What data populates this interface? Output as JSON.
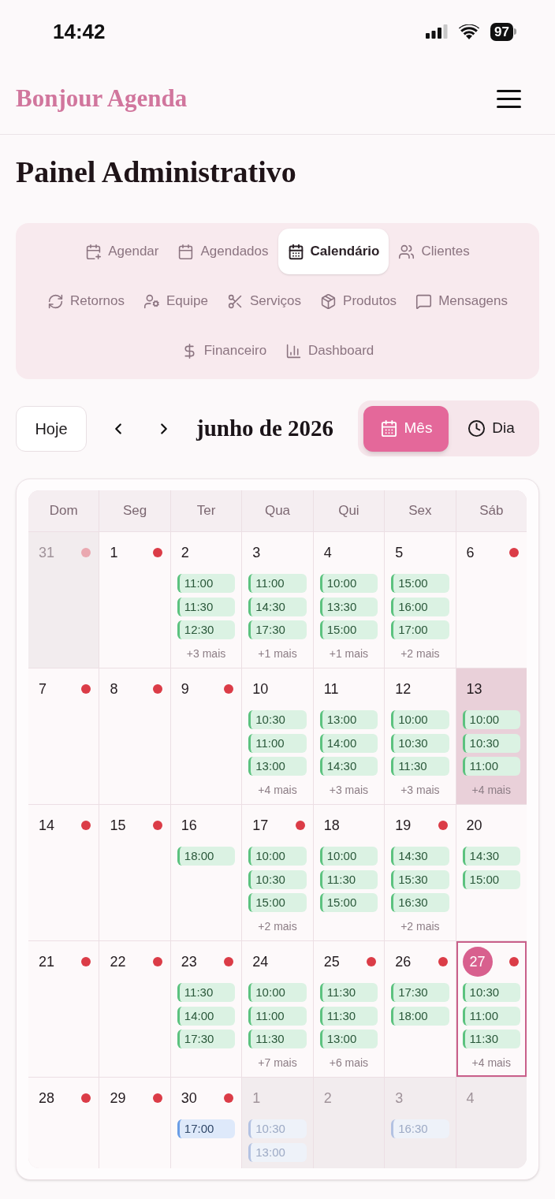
{
  "status_bar": {
    "time": "14:42",
    "battery": "97"
  },
  "header": {
    "brand": "Bonjour Agenda"
  },
  "page_title": "Painel Administrativo",
  "nav": [
    {
      "label": "Agendar",
      "selected": false
    },
    {
      "label": "Agendados",
      "selected": false
    },
    {
      "label": "Calendário",
      "selected": true
    },
    {
      "label": "Clientes",
      "selected": false
    },
    {
      "label": "Retornos",
      "selected": false
    },
    {
      "label": "Equipe",
      "selected": false
    },
    {
      "label": "Serviços",
      "selected": false
    },
    {
      "label": "Produtos",
      "selected": false
    },
    {
      "label": "Mensagens",
      "selected": false
    },
    {
      "label": "Financeiro",
      "selected": false
    },
    {
      "label": "Dashboard",
      "selected": false
    }
  ],
  "toolbar": {
    "today": "Hoje",
    "month_title": "junho de 2026"
  },
  "view_modes": [
    {
      "label": "Mês",
      "selected": true
    },
    {
      "label": "Dia",
      "selected": false
    }
  ],
  "calendar": {
    "weekdays": [
      "Dom",
      "Seg",
      "Ter",
      "Qua",
      "Qui",
      "Sex",
      "Sáb"
    ],
    "weeks": [
      [
        {
          "day": "31",
          "outside": true,
          "selected": false,
          "today": false,
          "dot": true
        },
        {
          "day": "1",
          "outside": false,
          "selected": false,
          "today": false,
          "dot": true
        },
        {
          "day": "2",
          "outside": false,
          "selected": false,
          "today": false,
          "dot": false,
          "events": [
            {
              "time": "11:00",
              "color": "#5cc27f"
            },
            {
              "time": "11:30",
              "color": "#5cc27f"
            },
            {
              "time": "12:30",
              "color": "#5cc27f"
            }
          ],
          "more": "+3 mais"
        },
        {
          "day": "3",
          "outside": false,
          "selected": false,
          "today": false,
          "dot": false,
          "events": [
            {
              "time": "11:00",
              "color": "#5cc27f"
            },
            {
              "time": "14:30",
              "color": "#5cc27f"
            },
            {
              "time": "17:30",
              "color": "#5cc27f"
            }
          ],
          "more": "+1 mais"
        },
        {
          "day": "4",
          "outside": false,
          "selected": false,
          "today": false,
          "dot": false,
          "events": [
            {
              "time": "10:00",
              "color": "#5cc27f"
            },
            {
              "time": "13:30",
              "color": "#5cc27f"
            },
            {
              "time": "15:00",
              "color": "#5cc27f"
            }
          ],
          "more": "+1 mais"
        },
        {
          "day": "5",
          "outside": false,
          "selected": false,
          "today": false,
          "dot": false,
          "events": [
            {
              "time": "15:00",
              "color": "#5cc27f"
            },
            {
              "time": "16:00",
              "color": "#5cc27f"
            },
            {
              "time": "17:00",
              "color": "#5cc27f"
            }
          ],
          "more": "+2 mais"
        },
        {
          "day": "6",
          "outside": false,
          "selected": false,
          "today": false,
          "dot": true
        }
      ],
      [
        {
          "day": "7",
          "outside": false,
          "selected": false,
          "today": false,
          "dot": true
        },
        {
          "day": "8",
          "outside": false,
          "selected": false,
          "today": false,
          "dot": true
        },
        {
          "day": "9",
          "outside": false,
          "selected": false,
          "today": false,
          "dot": true
        },
        {
          "day": "10",
          "outside": false,
          "selected": false,
          "today": false,
          "dot": false,
          "events": [
            {
              "time": "10:30",
              "color": "#5cc27f"
            },
            {
              "time": "11:00",
              "color": "#5cc27f"
            },
            {
              "time": "13:00",
              "color": "#5cc27f"
            }
          ],
          "more": "+4 mais"
        },
        {
          "day": "11",
          "outside": false,
          "selected": false,
          "today": false,
          "dot": false,
          "events": [
            {
              "time": "13:00",
              "color": "#5cc27f"
            },
            {
              "time": "14:00",
              "color": "#5cc27f"
            },
            {
              "time": "14:30",
              "color": "#5cc27f"
            }
          ],
          "more": "+3 mais"
        },
        {
          "day": "12",
          "outside": false,
          "selected": false,
          "today": false,
          "dot": false,
          "events": [
            {
              "time": "10:00",
              "color": "#5cc27f"
            },
            {
              "time": "10:30",
              "color": "#5cc27f"
            },
            {
              "time": "11:30",
              "color": "#5cc27f"
            }
          ],
          "more": "+3 mais"
        },
        {
          "day": "13",
          "outside": false,
          "selected": true,
          "today": false,
          "dot": false,
          "events": [
            {
              "time": "10:00",
              "color": "#5cc27f"
            },
            {
              "time": "10:30",
              "color": "#5cc27f"
            },
            {
              "time": "11:00",
              "color": "#5cc27f"
            }
          ],
          "more": "+4 mais"
        }
      ],
      [
        {
          "day": "14",
          "outside": false,
          "selected": false,
          "today": false,
          "dot": true
        },
        {
          "day": "15",
          "outside": false,
          "selected": false,
          "today": false,
          "dot": true
        },
        {
          "day": "16",
          "outside": false,
          "selected": false,
          "today": false,
          "dot": false,
          "events": [
            {
              "time": "18:00",
              "color": "#5cc27f"
            }
          ]
        },
        {
          "day": "17",
          "outside": false,
          "selected": false,
          "today": false,
          "dot": true,
          "events": [
            {
              "time": "10:00",
              "color": "#5cc27f"
            },
            {
              "time": "10:30",
              "color": "#5cc27f"
            },
            {
              "time": "15:00",
              "color": "#5cc27f"
            }
          ],
          "more": "+2 mais"
        },
        {
          "day": "18",
          "outside": false,
          "selected": false,
          "today": false,
          "dot": false,
          "events": [
            {
              "time": "10:00",
              "color": "#5cc27f"
            },
            {
              "time": "11:30",
              "color": "#5cc27f"
            },
            {
              "time": "15:00",
              "color": "#5cc27f"
            }
          ]
        },
        {
          "day": "19",
          "outside": false,
          "selected": false,
          "today": false,
          "dot": true,
          "events": [
            {
              "time": "14:30",
              "color": "#5cc27f"
            },
            {
              "time": "15:30",
              "color": "#5cc27f"
            },
            {
              "time": "16:30",
              "color": "#5cc27f"
            }
          ],
          "more": "+2 mais"
        },
        {
          "day": "20",
          "outside": false,
          "selected": false,
          "today": false,
          "dot": false,
          "events": [
            {
              "time": "14:30",
              "color": "#5cc27f"
            },
            {
              "time": "15:00",
              "color": "#5cc27f"
            }
          ]
        }
      ],
      [
        {
          "day": "21",
          "outside": false,
          "selected": false,
          "today": false,
          "dot": true
        },
        {
          "day": "22",
          "outside": false,
          "selected": false,
          "today": false,
          "dot": true
        },
        {
          "day": "23",
          "outside": false,
          "selected": false,
          "today": false,
          "dot": true,
          "events": [
            {
              "time": "11:30",
              "color": "#5cc27f"
            },
            {
              "time": "14:00",
              "color": "#5cc27f"
            },
            {
              "time": "17:30",
              "color": "#5cc27f"
            }
          ]
        },
        {
          "day": "24",
          "outside": false,
          "selected": false,
          "today": false,
          "dot": false,
          "events": [
            {
              "time": "10:00",
              "color": "#5cc27f"
            },
            {
              "time": "11:00",
              "color": "#5cc27f"
            },
            {
              "time": "11:30",
              "color": "#5cc27f"
            }
          ],
          "more": "+7 mais"
        },
        {
          "day": "25",
          "outside": false,
          "selected": false,
          "today": false,
          "dot": true,
          "events": [
            {
              "time": "11:30",
              "color": "#5cc27f"
            },
            {
              "time": "11:30",
              "color": "#5cc27f"
            },
            {
              "time": "13:00",
              "color": "#5cc27f"
            }
          ],
          "more": "+6 mais"
        },
        {
          "day": "26",
          "outside": false,
          "selected": false,
          "today": false,
          "dot": true,
          "events": [
            {
              "time": "17:30",
              "color": "#5cc27f"
            },
            {
              "time": "18:00",
              "color": "#5cc27f"
            }
          ]
        },
        {
          "day": "27",
          "outside": false,
          "selected": false,
          "today": true,
          "dot": true,
          "events": [
            {
              "time": "10:30",
              "color": "#5cc27f"
            },
            {
              "time": "11:00",
              "color": "#5cc27f"
            },
            {
              "time": "11:30",
              "color": "#5cc27f"
            }
          ],
          "more": "+4 mais"
        }
      ],
      [
        {
          "day": "28",
          "outside": false,
          "selected": false,
          "today": false,
          "dot": true
        },
        {
          "day": "29",
          "outside": false,
          "selected": false,
          "today": false,
          "dot": true
        },
        {
          "day": "30",
          "outside": false,
          "selected": false,
          "today": false,
          "dot": true,
          "events": [
            {
              "time": "17:00",
              "color": "#6a9de6"
            }
          ]
        },
        {
          "day": "1",
          "outside": true,
          "selected": false,
          "today": false,
          "dot": false,
          "events": [
            {
              "time": "10:30",
              "color": "#b3c2e2"
            },
            {
              "time": "13:00",
              "color": "#b3c2e2"
            }
          ]
        },
        {
          "day": "2",
          "outside": true,
          "selected": false,
          "today": false,
          "dot": false
        },
        {
          "day": "3",
          "outside": true,
          "selected": false,
          "today": false,
          "dot": false,
          "events": [
            {
              "time": "16:30",
              "color": "#b3c2e2"
            }
          ]
        },
        {
          "day": "4",
          "outside": true,
          "selected": false,
          "today": false,
          "dot": false
        }
      ]
    ]
  }
}
